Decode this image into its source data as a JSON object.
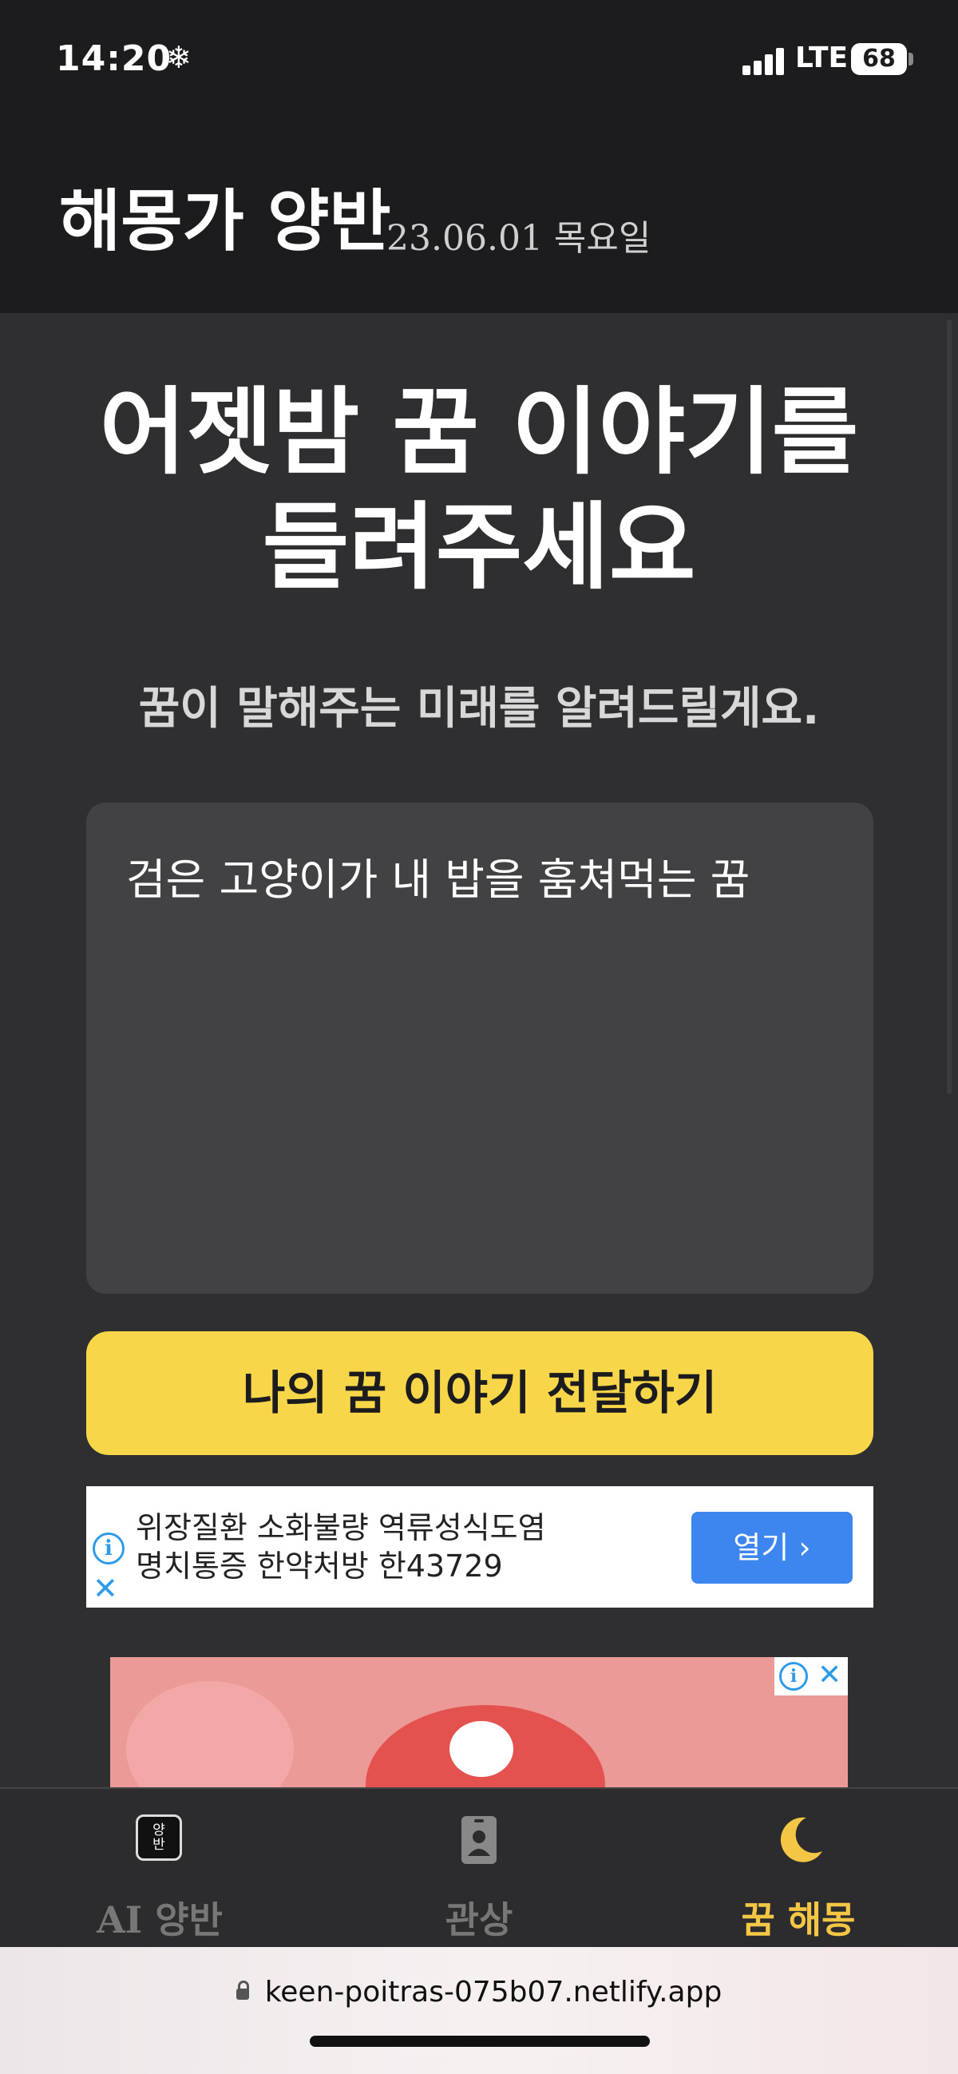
{
  "status_bar": {
    "time": "14:20",
    "snow_glyph": "❄",
    "network": "LTE",
    "battery": "68"
  },
  "header": {
    "brand": "해몽가 양반",
    "date": "23.06.01 목요일"
  },
  "main": {
    "headline_line1": "어젯밤 꿈 이야기를",
    "headline_line2": "들려주세요",
    "subtitle": "꿈이 말해주는 미래를 알려드릴게요.",
    "dream_input_value": "검은 고양이가 내 밥을 훔쳐먹는 꿈",
    "submit_label": "나의 꿈 이야기 전달하기"
  },
  "ad_banner": {
    "line1": "위장질환 소화불량 역류성식도염",
    "line2": "명치통증 한약처방 한43729",
    "open_label": "열기 ›",
    "info_glyph": "i",
    "close_glyph": "✕"
  },
  "image_ad": {
    "info_glyph": "i",
    "close_glyph": "✕"
  },
  "tabbar": {
    "tabs": [
      {
        "label": "AI 양반",
        "icon": "yangban-badge-icon",
        "badge_text": "양\n반",
        "active": false
      },
      {
        "label": "관상",
        "icon": "id-badge-icon",
        "active": false
      },
      {
        "label": "꿈 해몽",
        "icon": "moon-icon",
        "active": true
      }
    ]
  },
  "browser": {
    "url": "keen-poitras-075b07.netlify.app"
  },
  "colors": {
    "accent_yellow": "#f7d64a",
    "active_tab": "#f3c646",
    "ad_blue": "#3d86f0"
  }
}
